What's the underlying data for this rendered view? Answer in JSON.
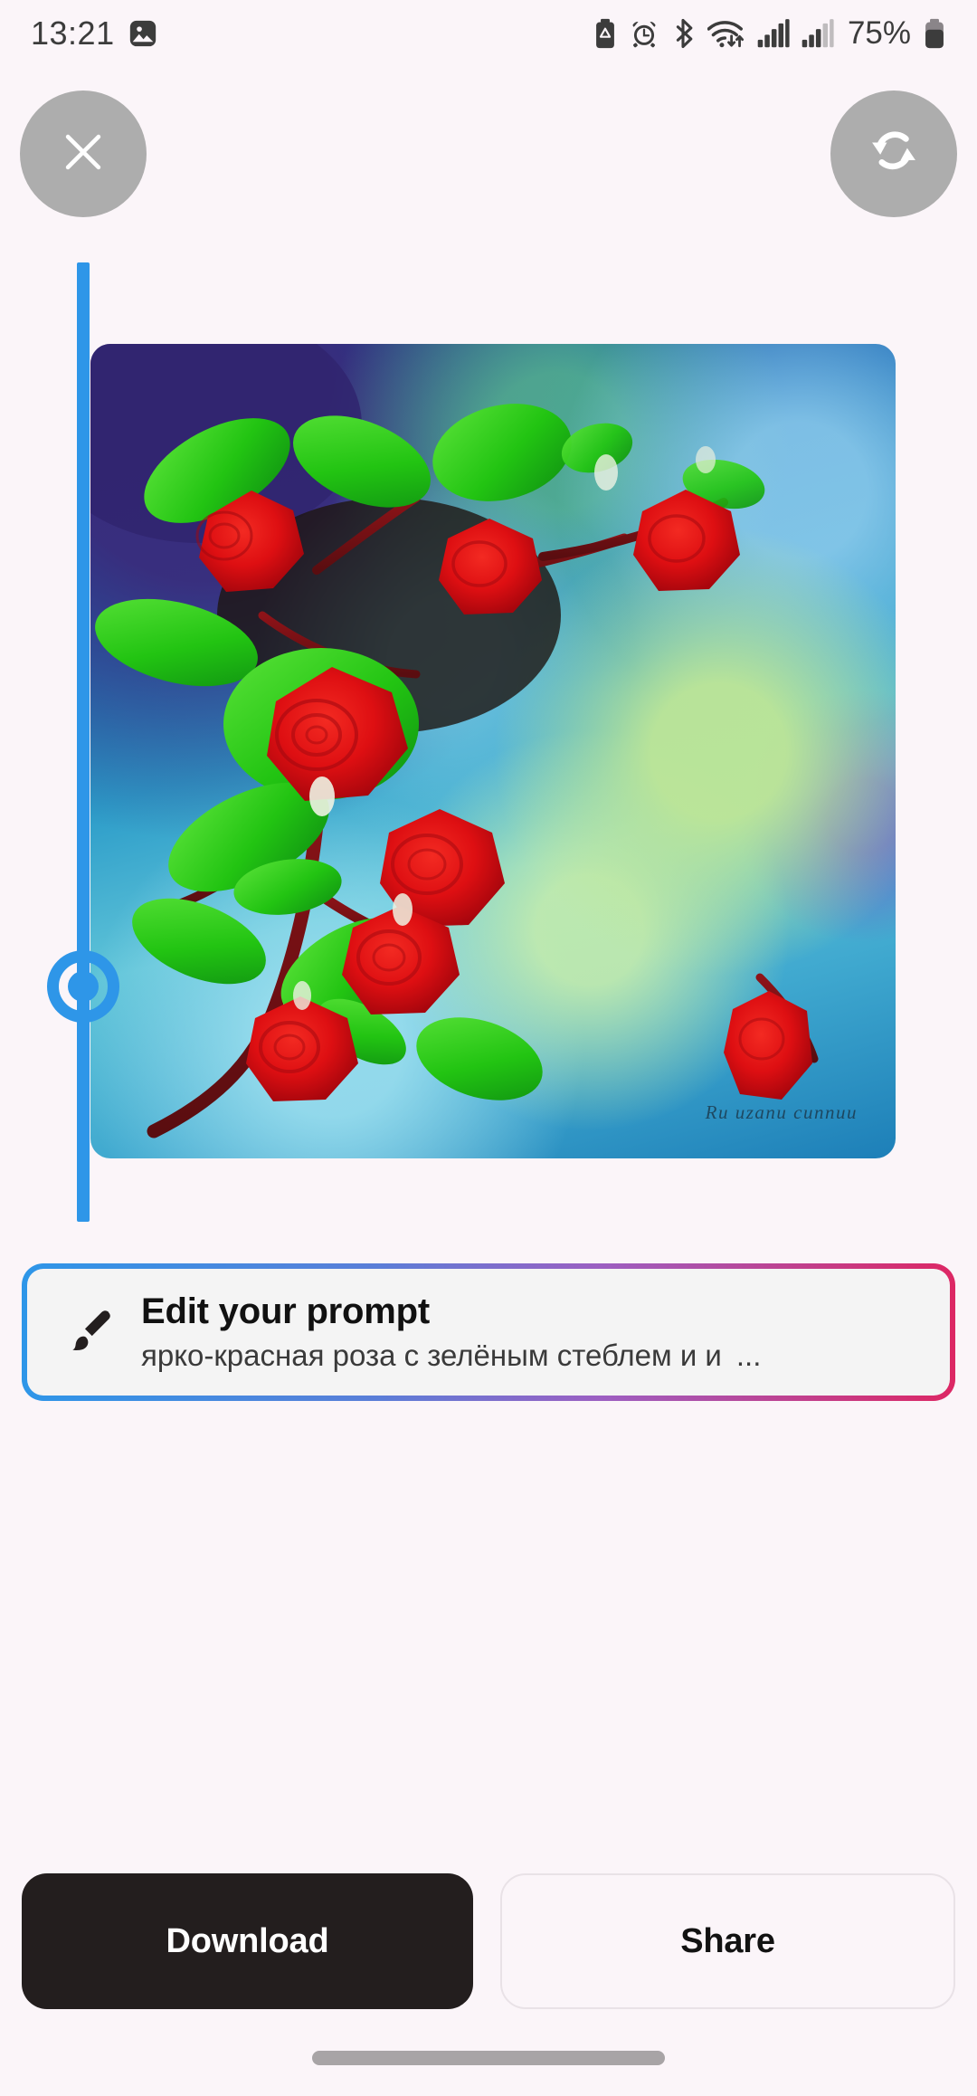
{
  "status_bar": {
    "time": "13:21",
    "battery_percent": "75%",
    "left_icons": [
      "gallery-image-notification-icon"
    ],
    "right_icons": [
      "battery-saver-icon",
      "alarm-icon",
      "bluetooth-icon",
      "wifi-icon",
      "signal-sim1-icon",
      "signal-sim2-icon",
      "battery-icon"
    ]
  },
  "top_controls": {
    "close_label": "Close",
    "refresh_label": "Regenerate",
    "button_color": "#ADADAD"
  },
  "preview": {
    "slider_name": "before-after-compare-slider",
    "slider_color": "#2E96E8",
    "image_alt": "Generated image of bright red roses with green leaves on a blue bokeh background",
    "image_watermark": "Ru uzanu cunnuu"
  },
  "prompt_card": {
    "title": "Edit your prompt",
    "prompt_value": "ярко-красная роза с зелёным стеблем и и",
    "ellipsis": "...",
    "icon": "paintbrush-icon",
    "border_gradient_start": "#2E96E8",
    "border_gradient_end": "#DD2764"
  },
  "actions": {
    "download_label": "Download",
    "share_label": "Share",
    "download_bg": "#231E1E"
  }
}
